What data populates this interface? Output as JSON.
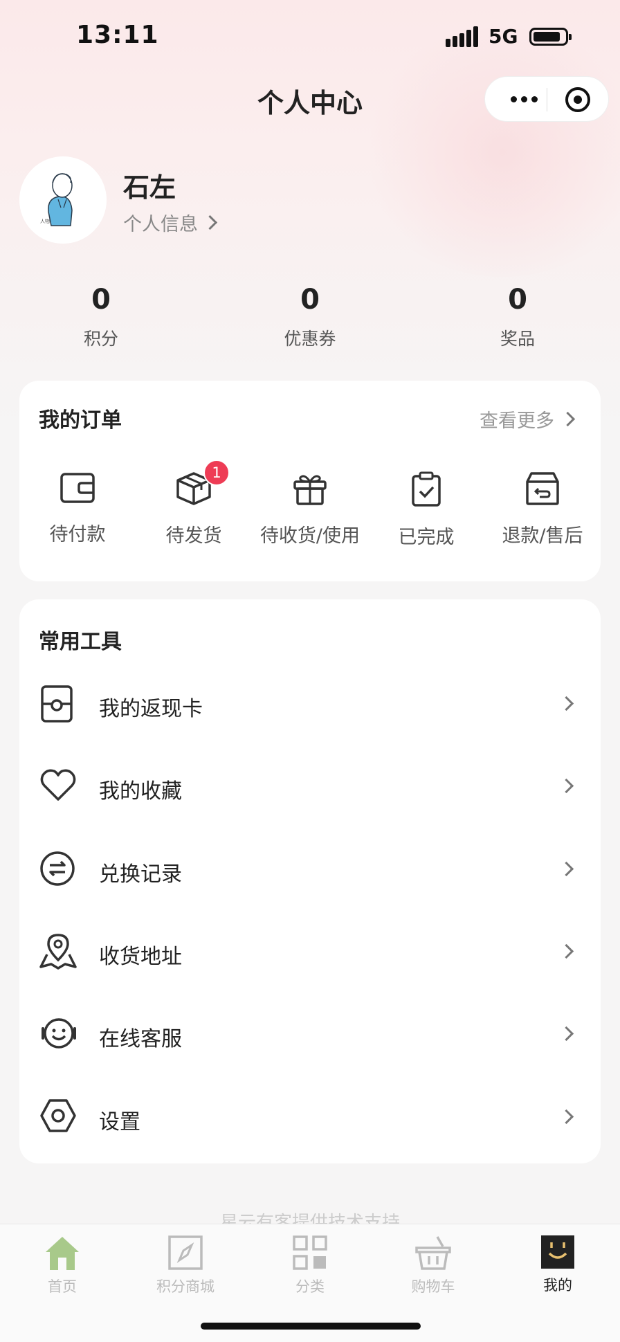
{
  "status_bar": {
    "time": "13:11",
    "network": "5G"
  },
  "nav": {
    "title": "个人中心"
  },
  "profile": {
    "name": "石左",
    "info_link": "个人信息"
  },
  "stats": [
    {
      "value": "0",
      "label": "积分"
    },
    {
      "value": "0",
      "label": "优惠券"
    },
    {
      "value": "0",
      "label": "奖品"
    }
  ],
  "orders": {
    "title": "我的订单",
    "more": "查看更多",
    "items": [
      {
        "label": "待付款",
        "icon": "wallet-icon"
      },
      {
        "label": "待发货",
        "icon": "package-icon",
        "badge": "1"
      },
      {
        "label": "待收货/使用",
        "icon": "gift-icon"
      },
      {
        "label": "已完成",
        "icon": "clipboard-check-icon"
      },
      {
        "label": "退款/售后",
        "icon": "return-box-icon"
      }
    ]
  },
  "tools": {
    "title": "常用工具",
    "items": [
      {
        "label": "我的返现卡",
        "icon": "card-icon"
      },
      {
        "label": "我的收藏",
        "icon": "heart-icon"
      },
      {
        "label": "兑换记录",
        "icon": "exchange-icon"
      },
      {
        "label": "收货地址",
        "icon": "map-pin-icon"
      },
      {
        "label": "在线客服",
        "icon": "customer-service-icon"
      },
      {
        "label": "设置",
        "icon": "hexagon-settings-icon"
      }
    ]
  },
  "footer_note": "星云有客提供技术支持",
  "tabbar": {
    "items": [
      {
        "label": "首页",
        "icon": "home-icon",
        "active": false
      },
      {
        "label": "积分商城",
        "icon": "compass-icon",
        "active": false
      },
      {
        "label": "分类",
        "icon": "grid-icon",
        "active": false
      },
      {
        "label": "购物车",
        "icon": "basket-icon",
        "active": false
      },
      {
        "label": "我的",
        "icon": "profile-face-icon",
        "active": true
      }
    ]
  },
  "colors": {
    "badge": "#ee3c55",
    "home_tab_icon": "#a8c98a",
    "background": "#f6f5f5"
  }
}
